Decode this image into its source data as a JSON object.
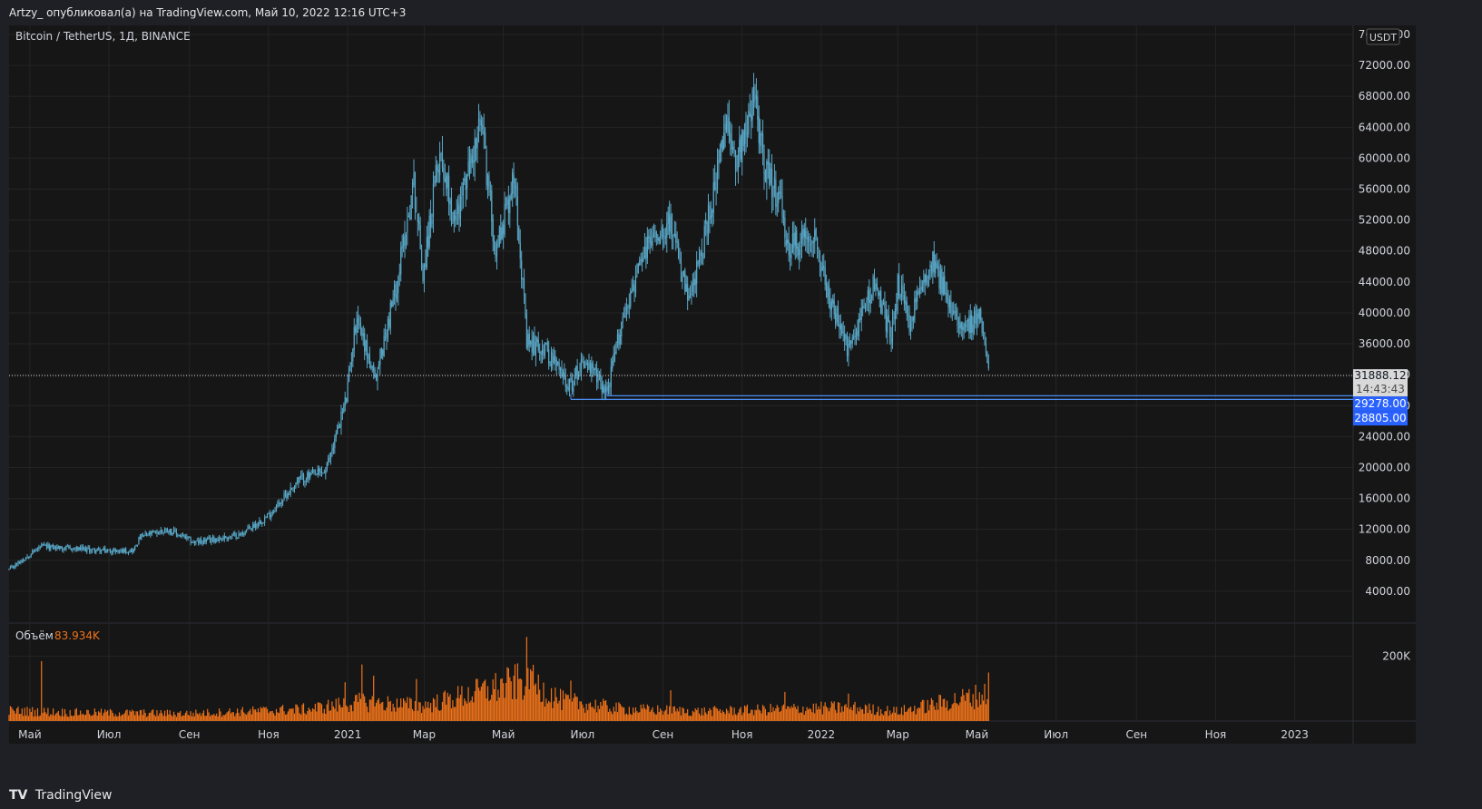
{
  "header": {
    "text": "Artzy_ опубликовал(а) на TradingView.com, Май 10, 2022 12:16 UTC+3"
  },
  "footer": {
    "logo_mark": "TV",
    "brand": "TradingView"
  },
  "chart_data": {
    "type": "candlestick",
    "symbol_label": "Bitcoin / TetherUS, 1Д, BINANCE",
    "currency": "USDT",
    "colors": {
      "up": "#5aa9c9",
      "down": "#5aa9c9",
      "volume": "#f0731a",
      "level": "#4a8cf0",
      "background": "#161616"
    },
    "y_range": [
      0,
      76000
    ],
    "y_ticks": [
      4000,
      8000,
      12000,
      16000,
      20000,
      24000,
      28000,
      32000,
      36000,
      40000,
      44000,
      48000,
      52000,
      56000,
      60000,
      64000,
      68000,
      72000,
      76000
    ],
    "y_tick_labels": [
      "4000.00",
      "8000.00",
      "12000.00",
      "16000.00",
      "20000.00",
      "24000.00",
      "28000.00",
      "32000.00",
      "36000.00",
      "40000.00",
      "44000.00",
      "48000.00",
      "52000.00",
      "56000.00",
      "60000.00",
      "64000.00",
      "68000.00",
      "72000.00",
      "76000.00"
    ],
    "x_range": [
      "2020-04-15",
      "2023-02-15"
    ],
    "x_ticks": [
      {
        "date": "2020-05-01",
        "label": "Май"
      },
      {
        "date": "2020-07-01",
        "label": "Июл"
      },
      {
        "date": "2020-09-01",
        "label": "Сен"
      },
      {
        "date": "2020-11-01",
        "label": "Ноя"
      },
      {
        "date": "2021-01-01",
        "label": "2021"
      },
      {
        "date": "2021-03-01",
        "label": "Мар"
      },
      {
        "date": "2021-05-01",
        "label": "Май"
      },
      {
        "date": "2021-07-01",
        "label": "Июл"
      },
      {
        "date": "2021-09-01",
        "label": "Сен"
      },
      {
        "date": "2021-11-01",
        "label": "Ноя"
      },
      {
        "date": "2022-01-01",
        "label": "2022"
      },
      {
        "date": "2022-03-01",
        "label": "Мар"
      },
      {
        "date": "2022-05-01",
        "label": "Май"
      },
      {
        "date": "2022-07-01",
        "label": "Июл"
      },
      {
        "date": "2022-09-01",
        "label": "Сен"
      },
      {
        "date": "2022-11-01",
        "label": "Ноя"
      },
      {
        "date": "2023-01-01",
        "label": "2023"
      }
    ],
    "price_path": [
      [
        "2020-04-15",
        6800
      ],
      [
        "2020-05-01",
        8800
      ],
      [
        "2020-05-10",
        9800
      ],
      [
        "2020-06-01",
        9500
      ],
      [
        "2020-07-01",
        9200
      ],
      [
        "2020-07-20",
        9300
      ],
      [
        "2020-07-25",
        11000
      ],
      [
        "2020-08-15",
        12000
      ],
      [
        "2020-09-05",
        10300
      ],
      [
        "2020-10-10",
        11300
      ],
      [
        "2020-11-01",
        13800
      ],
      [
        "2020-11-25",
        18500
      ],
      [
        "2020-12-15",
        19500
      ],
      [
        "2020-12-31",
        29000
      ],
      [
        "2021-01-08",
        40000
      ],
      [
        "2021-01-22",
        31000
      ],
      [
        "2021-02-08",
        44000
      ],
      [
        "2021-02-21",
        57000
      ],
      [
        "2021-02-28",
        45000
      ],
      [
        "2021-03-13",
        61000
      ],
      [
        "2021-03-25",
        52000
      ],
      [
        "2021-04-14",
        64500
      ],
      [
        "2021-04-25",
        48000
      ],
      [
        "2021-05-10",
        58000
      ],
      [
        "2021-05-19",
        36000
      ],
      [
        "2021-06-01",
        35500
      ],
      [
        "2021-06-22",
        30500
      ],
      [
        "2021-07-01",
        34000
      ],
      [
        "2021-07-20",
        29800
      ],
      [
        "2021-08-01",
        39500
      ],
      [
        "2021-08-22",
        49500
      ],
      [
        "2021-09-06",
        52000
      ],
      [
        "2021-09-21",
        41000
      ],
      [
        "2021-10-01",
        48000
      ],
      [
        "2021-10-20",
        64000
      ],
      [
        "2021-10-28",
        60000
      ],
      [
        "2021-11-10",
        68000
      ],
      [
        "2021-11-20",
        58000
      ],
      [
        "2021-12-03",
        53000
      ],
      [
        "2021-12-04",
        48000
      ],
      [
        "2021-12-27",
        50500
      ],
      [
        "2022-01-05",
        43000
      ],
      [
        "2022-01-22",
        35000
      ],
      [
        "2022-02-10",
        44000
      ],
      [
        "2022-02-24",
        37000
      ],
      [
        "2022-03-01",
        44000
      ],
      [
        "2022-03-10",
        38500
      ],
      [
        "2022-03-28",
        47500
      ],
      [
        "2022-04-11",
        40000
      ],
      [
        "2022-04-25",
        38500
      ],
      [
        "2022-05-04",
        39500
      ],
      [
        "2022-05-10",
        31888
      ]
    ],
    "volume_label": "Объём",
    "volume_value_label": "83.934K",
    "volume_range": [
      0,
      300000
    ],
    "volume_tick_labels": [
      "200K"
    ],
    "volume_ticks": [
      200000
    ],
    "volume_path": [
      [
        "2020-04-15",
        30000
      ],
      [
        "2020-06-01",
        25000
      ],
      [
        "2020-09-01",
        22000
      ],
      [
        "2020-12-01",
        35000
      ],
      [
        "2021-01-10",
        55000
      ],
      [
        "2021-03-01",
        45000
      ],
      [
        "2021-05-19",
        120000
      ],
      [
        "2021-06-15",
        60000
      ],
      [
        "2021-08-01",
        35000
      ],
      [
        "2021-10-01",
        28000
      ],
      [
        "2021-12-04",
        35000
      ],
      [
        "2022-01-22",
        40000
      ],
      [
        "2022-03-01",
        28000
      ],
      [
        "2022-05-10",
        80000
      ]
    ],
    "volume_spikes": [
      [
        "2021-05-19",
        260000
      ],
      [
        "2021-05-22",
        160000
      ],
      [
        "2021-01-12",
        175000
      ],
      [
        "2021-02-23",
        130000
      ],
      [
        "2021-01-21",
        140000
      ],
      [
        "2020-05-10",
        185000
      ],
      [
        "2022-05-10",
        150000
      ],
      [
        "2021-06-22",
        125000
      ],
      [
        "2021-09-07",
        95000
      ],
      [
        "2021-12-04",
        90000
      ],
      [
        "2022-01-22",
        85000
      ],
      [
        "2020-12-30",
        120000
      ]
    ],
    "current_price": {
      "label": "31888.12",
      "countdown": "14:43:43",
      "value": 31888.12
    },
    "levels": [
      {
        "label": "29278.00",
        "value": 29278,
        "from": "2021-07-20"
      },
      {
        "label": "28805.00",
        "value": 28805,
        "from": "2021-06-22"
      }
    ]
  }
}
